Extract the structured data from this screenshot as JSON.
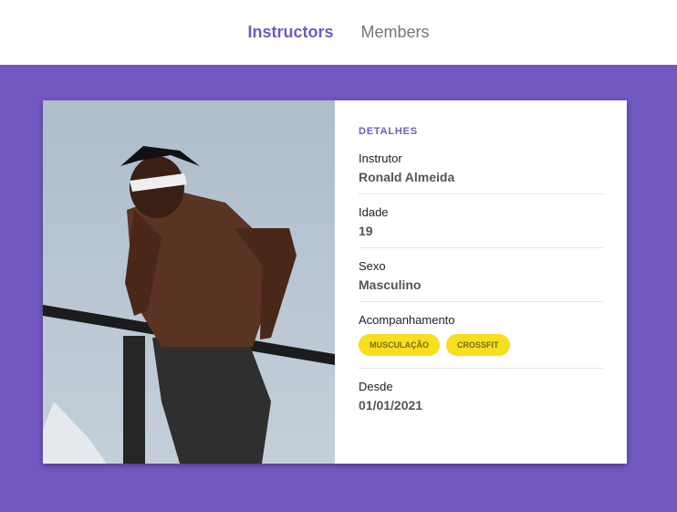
{
  "nav": {
    "instructors": "Instructors",
    "members": "Members"
  },
  "card": {
    "image_alt": "Instrutor fazendo exercício na barra",
    "details_title": "Detalhes",
    "instructor": {
      "label": "Instrutor",
      "value": "Ronald Almeida"
    },
    "age": {
      "label": "Idade",
      "value": "19"
    },
    "gender": {
      "label": "Sexo",
      "value": "Masculino"
    },
    "services": {
      "label": "Acompanhamento",
      "tags": [
        "Musculação",
        "Crossfit"
      ]
    },
    "since": {
      "label": "Desde",
      "value": "01/01/2021"
    }
  },
  "colors": {
    "accent": "#7259c1",
    "tag": "#f7df1e"
  }
}
